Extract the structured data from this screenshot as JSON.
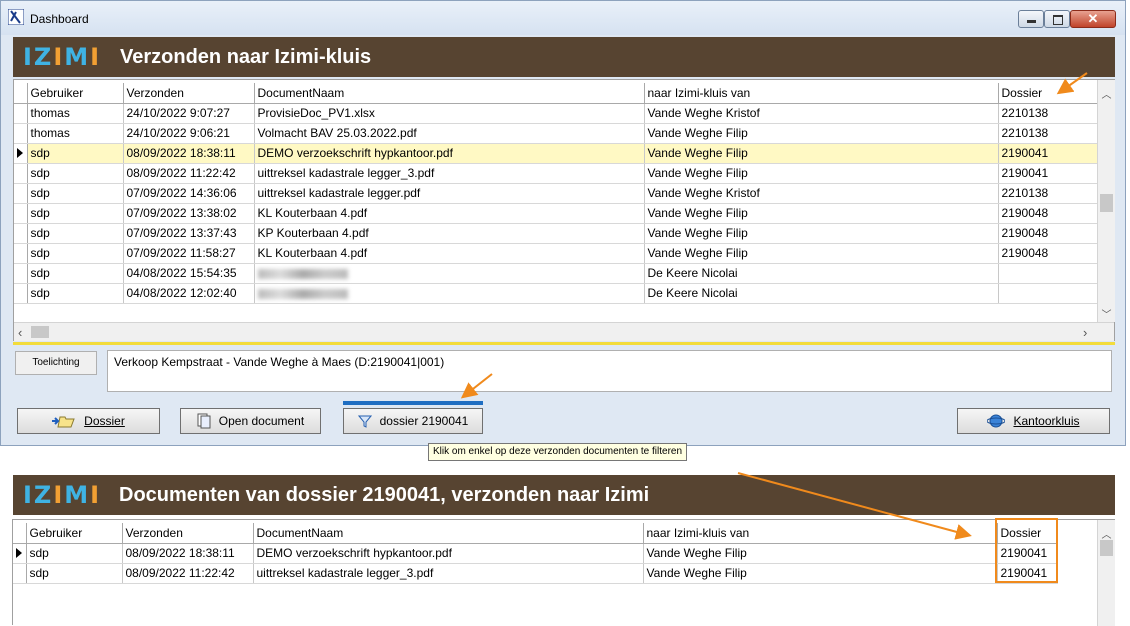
{
  "window": {
    "title": "Dashboard"
  },
  "top": {
    "logo": "IZIMI",
    "heading": "Verzonden naar Izimi-kluis",
    "columns": [
      "Gebruiker",
      "Verzonden",
      "DocumentNaam",
      "naar Izimi-kluis van",
      "Dossier"
    ],
    "rows": [
      {
        "user": "thomas",
        "sent": "24/10/2022 9:07:27",
        "doc": "ProvisieDoc_PV1.xlsx",
        "owner": "Vande Weghe Kristof",
        "dossier": "2210138"
      },
      {
        "user": "thomas",
        "sent": "24/10/2022 9:06:21",
        "doc": "Volmacht BAV 25.03.2022.pdf",
        "owner": "Vande Weghe Filip",
        "dossier": "2210138"
      },
      {
        "user": "sdp",
        "sent": "08/09/2022 18:38:11",
        "doc": "DEMO verzoekschrift hypkantoor.pdf",
        "owner": "Vande Weghe Filip",
        "dossier": "2190041"
      },
      {
        "user": "sdp",
        "sent": "08/09/2022 11:22:42",
        "doc": "uittreksel kadastrale legger_3.pdf",
        "owner": "Vande Weghe Filip",
        "dossier": "2190041"
      },
      {
        "user": "sdp",
        "sent": "07/09/2022 14:36:06",
        "doc": "uittreksel kadastrale legger.pdf",
        "owner": "Vande Weghe Kristof",
        "dossier": "2210138"
      },
      {
        "user": "sdp",
        "sent": "07/09/2022 13:38:02",
        "doc": "KL Kouterbaan 4.pdf",
        "owner": "Vande Weghe Filip",
        "dossier": "2190048"
      },
      {
        "user": "sdp",
        "sent": "07/09/2022 13:37:43",
        "doc": "KP Kouterbaan 4.pdf",
        "owner": "Vande Weghe Filip",
        "dossier": "2190048"
      },
      {
        "user": "sdp",
        "sent": "07/09/2022 11:58:27",
        "doc": "KL Kouterbaan 4.pdf",
        "owner": "Vande Weghe Filip",
        "dossier": "2190048"
      },
      {
        "user": "sdp",
        "sent": "04/08/2022 15:54:35",
        "doc": "",
        "owner": "De Keere Nicolai",
        "dossier": ""
      },
      {
        "user": "sdp",
        "sent": "04/08/2022 12:02:40",
        "doc": "",
        "owner": "De Keere Nicolai",
        "dossier": ""
      }
    ],
    "selected_row": 2
  },
  "note": {
    "label": "Toelichting",
    "text": "Verkoop Kempstraat - Vande Weghe à Maes (D:2190041|001)"
  },
  "buttons": {
    "dossier": "Dossier",
    "open_document": "Open document",
    "filter": "dossier 2190041",
    "kantoorkluis": "Kantoorkluis"
  },
  "tooltip": "Klik om enkel op deze verzonden documenten te filteren",
  "bottom": {
    "logo": "IZIMI",
    "heading": "Documenten van dossier 2190041, verzonden naar Izimi",
    "columns": [
      "Gebruiker",
      "Verzonden",
      "DocumentNaam",
      "naar Izimi-kluis van",
      "Dossier"
    ],
    "rows": [
      {
        "user": "sdp",
        "sent": "08/09/2022 18:38:11",
        "doc": "DEMO verzoekschrift hypkantoor.pdf",
        "owner": "Vande Weghe Filip",
        "dossier": "2190041"
      },
      {
        "user": "sdp",
        "sent": "08/09/2022 11:22:42",
        "doc": "uittreksel kadastrale legger_3.pdf",
        "owner": "Vande Weghe Filip",
        "dossier": "2190041"
      }
    ]
  },
  "colors": {
    "brand_bar": "#574431",
    "logo_blue": "#3fb3e3",
    "logo_orange": "#f2a033",
    "annotation": "#f08a1c",
    "selected_row": "#fff9c4"
  }
}
